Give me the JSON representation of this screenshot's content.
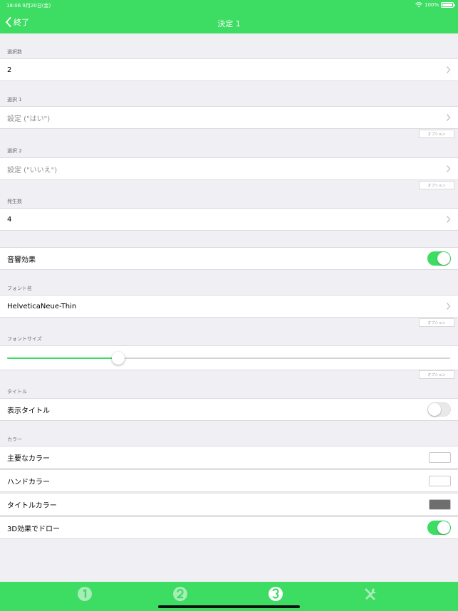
{
  "status": {
    "time_date": "18:06   9月20日(金)",
    "battery": "100%"
  },
  "nav": {
    "back_label": "終了",
    "title": "決定 1"
  },
  "sections": {
    "choices_count": {
      "header": "選択数",
      "value": "2"
    },
    "choice1": {
      "header": "選択 1",
      "value": "設定 (\"はい\")",
      "option": "オプション"
    },
    "choice2": {
      "header": "選択 2",
      "value": "設定 (\"いいえ\")",
      "option": "オプション"
    },
    "occurrences": {
      "header": "発生数",
      "value": "4"
    },
    "sound": {
      "label": "音響効果",
      "on": true
    },
    "font_name": {
      "header": "フォント名",
      "value": "HelveticaNeue-Thin",
      "option": "オプション"
    },
    "font_size": {
      "header": "フォントサイズ",
      "slider_fraction": 0.25,
      "option": "オプション"
    },
    "title": {
      "header": "タイトル",
      "label": "表示タイトル",
      "on": false
    },
    "colors": {
      "header": "カラー",
      "items": [
        {
          "label": "主要なカラー",
          "color": "#ffffff"
        },
        {
          "label": "ハンドカラー",
          "color": "#ffffff"
        },
        {
          "label": "タイトルカラー",
          "color": "#6e6e6e"
        }
      ],
      "draw3d": {
        "label": "3D効果でドロー",
        "on": true
      }
    }
  },
  "tabs": [
    {
      "icon": "number-1-icon",
      "selected": false
    },
    {
      "icon": "number-2-icon",
      "selected": false
    },
    {
      "icon": "number-3-icon",
      "selected": true
    },
    {
      "icon": "tools-icon",
      "selected": false
    }
  ],
  "colors": {
    "accent": "#3ddc63",
    "background": "#efeff4"
  }
}
